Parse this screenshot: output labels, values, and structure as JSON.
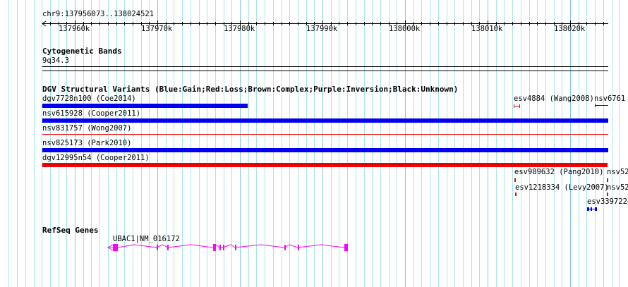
{
  "ruler": {
    "region": "chr9:137956073..138024521",
    "ticks": [
      "137960k",
      "137970k",
      "137980k",
      "137990k",
      "138000k",
      "138010k",
      "138020k"
    ]
  },
  "tracks": {
    "cyto": {
      "title": "Cytogenetic Bands",
      "band": "9q34.3"
    },
    "dgv": {
      "title": "DGV Structural Variants (Blue:Gain;Red:Loss;Brown:Complex;Purple:Inversion;Black:Unknown)",
      "features": [
        "dgv7728n100 (Coe2014)",
        "esv4884 (Wang2008)",
        "nsv6761",
        "nsv615928 (Cooper2011)",
        "nsv831757 (Wong2007)",
        "nsv825173 (Park2010)",
        "dgv12995n54 (Cooper2011)",
        "esv989632 (Pang2010)",
        "nsv52",
        "esv1218334 (Levy2007)",
        "nsv52",
        "esv3397224"
      ]
    },
    "refseq": {
      "title": "RefSeq Genes",
      "gene": "UBAC1|NM_016172"
    }
  },
  "colors": {
    "gain": "#0000ee",
    "loss": "#ee0000",
    "gene": "#ff00ff",
    "grid": "#a8e4ec",
    "grid_major": "#80c8e8"
  }
}
